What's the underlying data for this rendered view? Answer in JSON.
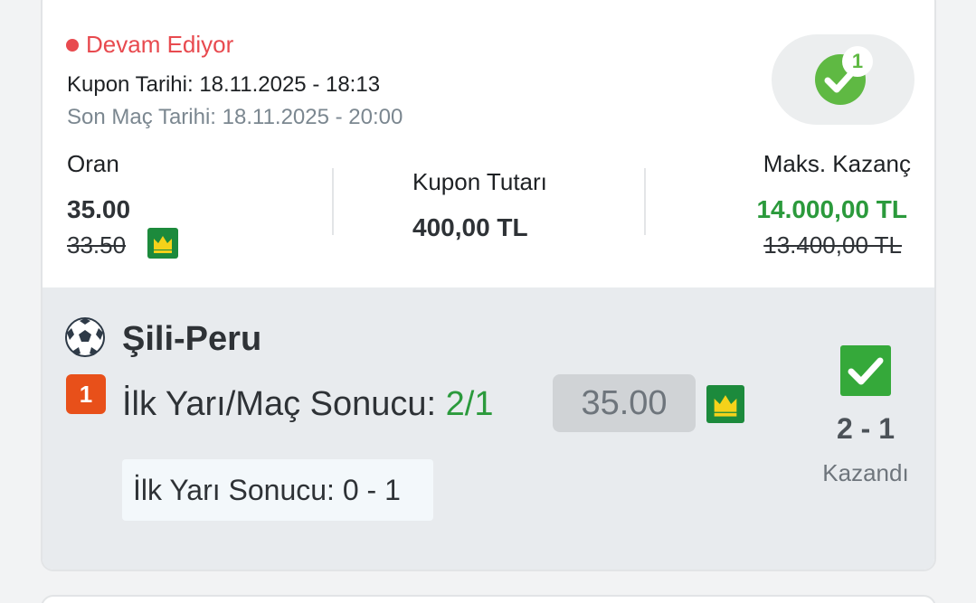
{
  "coupon": {
    "status": "Devam Ediyor",
    "coupon_date": "Kupon Tarihi: 18.11.2025 - 18:13",
    "last_match_date": "Son Maç Tarihi: 18.11.2025 - 20:00",
    "won_count": "1",
    "odds": {
      "label": "Oran",
      "value": "35.00",
      "old_value": "33.50"
    },
    "stake": {
      "label": "Kupon Tutarı",
      "value": "400,00 TL"
    },
    "max_win": {
      "label": "Maks. Kazanç",
      "value": "14.000,00 TL",
      "old_value": "13.400,00 TL"
    }
  },
  "match": {
    "teams": "Şili-Peru",
    "index": "1",
    "market_label": "İlk Yarı/Maç Sonucu: ",
    "pick": "2/1",
    "odd": "35.00",
    "half_time": "İlk Yarı Sonucu: 0 - 1",
    "score": "2 - 1",
    "result": "Kazandı"
  },
  "colors": {
    "live": "#e84a4f",
    "win_green": "#2b9a3c",
    "check_green": "#5fb943",
    "crown_bg": "#1c8a3c",
    "crown_gold": "#f5d21a"
  },
  "icons": [
    "live-dot-icon",
    "check-circle-icon",
    "crown-icon",
    "soccer-ball-icon",
    "check-square-icon"
  ]
}
